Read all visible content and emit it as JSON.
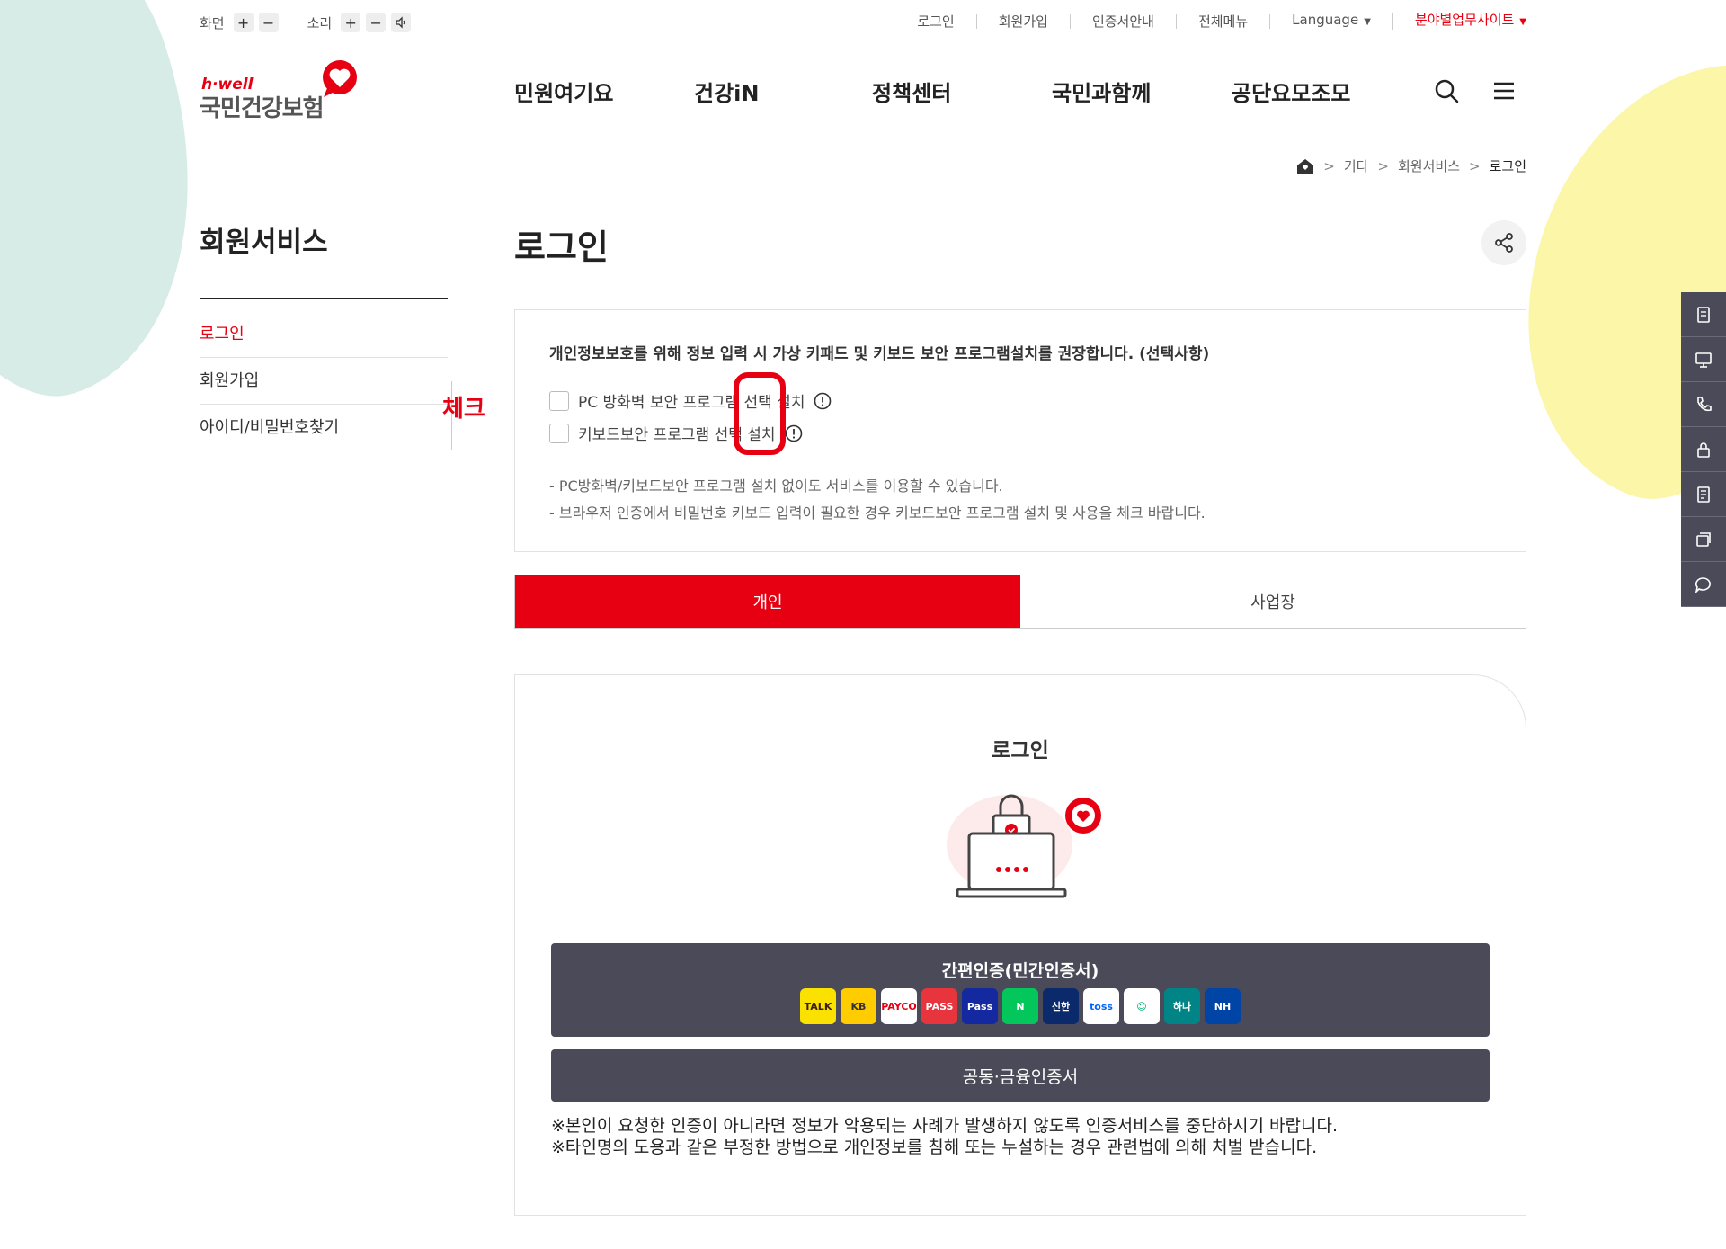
{
  "util": {
    "screen_label": "화면",
    "sound_label": "소리",
    "plus": "+",
    "minus": "−",
    "links": [
      "로그인",
      "회원가입",
      "인증서안내",
      "전체메뉴",
      "Language",
      "분야별업무사이트"
    ]
  },
  "logo": {
    "brand": "h·well",
    "name": "국민건강보험"
  },
  "gnb": [
    "민원여기요",
    "건강iN",
    "정책센터",
    "국민과함께",
    "공단요모조모"
  ],
  "breadcrumb": [
    "기타",
    "회원서비스",
    "로그인"
  ],
  "side": {
    "title": "회원서비스",
    "items": [
      "로그인",
      "회원가입",
      "아이디/비밀번호찾기"
    ]
  },
  "annotation": "체크",
  "page_title": "로그인",
  "security": {
    "heading": "개인정보보호를 위해 정보 입력 시 가상 키패드 및 키보드 보안 프로그램설치를 권장합니다. (선택사항)",
    "options": [
      "PC 방화벽 보안 프로그램 선택 설치",
      "키보드보안 프로그램 선택 설치"
    ],
    "notes": [
      "- PC방화벽/키보드보안 프로그램 설치 없이도 서비스를 이용할 수 있습니다.",
      "- 브라우저 인증에서 비밀번호 키보드 입력이 필요한 경우 키보드보안 프로그램 설치 및 사용을 체크 바랍니다."
    ]
  },
  "tabs": [
    "개인",
    "사업장"
  ],
  "login": {
    "title": "로그인",
    "easy_auth": "간편인증(민간인증서)",
    "providers": [
      {
        "label": "TALK",
        "color": "#fae100",
        "text": "#3c1e1e"
      },
      {
        "label": "KB",
        "color": "#ffcc00",
        "text": "#333333"
      },
      {
        "label": "PAYCO",
        "color": "#ffffff",
        "text": "#e60012"
      },
      {
        "label": "PASS",
        "color": "#e8343c",
        "text": "#ffffff"
      },
      {
        "label": "Pass",
        "color": "#1428a0",
        "text": "#ffffff"
      },
      {
        "label": "N",
        "color": "#03c75a",
        "text": "#ffffff"
      },
      {
        "label": "신한",
        "color": "#0a2a6b",
        "text": "#ffffff"
      },
      {
        "label": "toss",
        "color": "#ffffff",
        "text": "#0064ff"
      },
      {
        "label": "☺",
        "color": "#ffffff",
        "text": "#00a86b"
      },
      {
        "label": "하나",
        "color": "#008485",
        "text": "#ffffff"
      },
      {
        "label": "NH",
        "color": "#0044a5",
        "text": "#ffffff"
      }
    ],
    "cert": "공동·금융인증서",
    "warnings": [
      "※본인이 요청한 인증이 아니라면 정보가 악용되는 사례가 발생하지 않도록 인증서비스를 중단하시기 바랍니다.",
      "※타인명의 도용과 같은 부정한 방법으로 개인정보를 침해 또는 누설하는 경우 관련법에 의해 처벌 받습니다."
    ]
  },
  "colors": {
    "brand_red": "#e60012",
    "dark_button": "#4a4a58"
  }
}
